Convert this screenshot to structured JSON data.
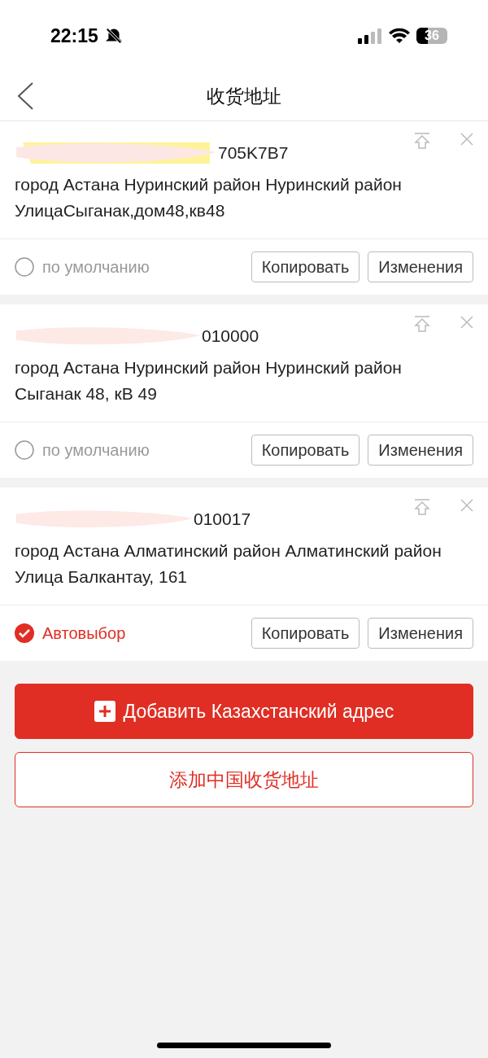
{
  "status_bar": {
    "time": "22:15",
    "battery": "36"
  },
  "header": {
    "title": "收货地址"
  },
  "addresses": [
    {
      "recipient": "705K7B7",
      "address": "город Астана Нуринский район Нуринский район УлицаСыганак,дом48,кв48",
      "default_label": "по умолчанию",
      "selected": false,
      "copy": "Копировать",
      "edit": "Изменения"
    },
    {
      "recipient": "010000",
      "address": "город Астана Нуринский район Нуринский район Сыганак 48, кВ 49",
      "default_label": "по умолчанию",
      "selected": false,
      "copy": "Копировать",
      "edit": "Изменения"
    },
    {
      "recipient": "010017",
      "address": "город Астана Алматинский район Алматинский район Улица Балкантау, 161",
      "default_label": "Автовыбор",
      "selected": true,
      "copy": "Копировать",
      "edit": "Изменения"
    }
  ],
  "buttons": {
    "add_kz": "Добавить Казахстанский адрес",
    "add_cn": "添加中国收货地址"
  }
}
